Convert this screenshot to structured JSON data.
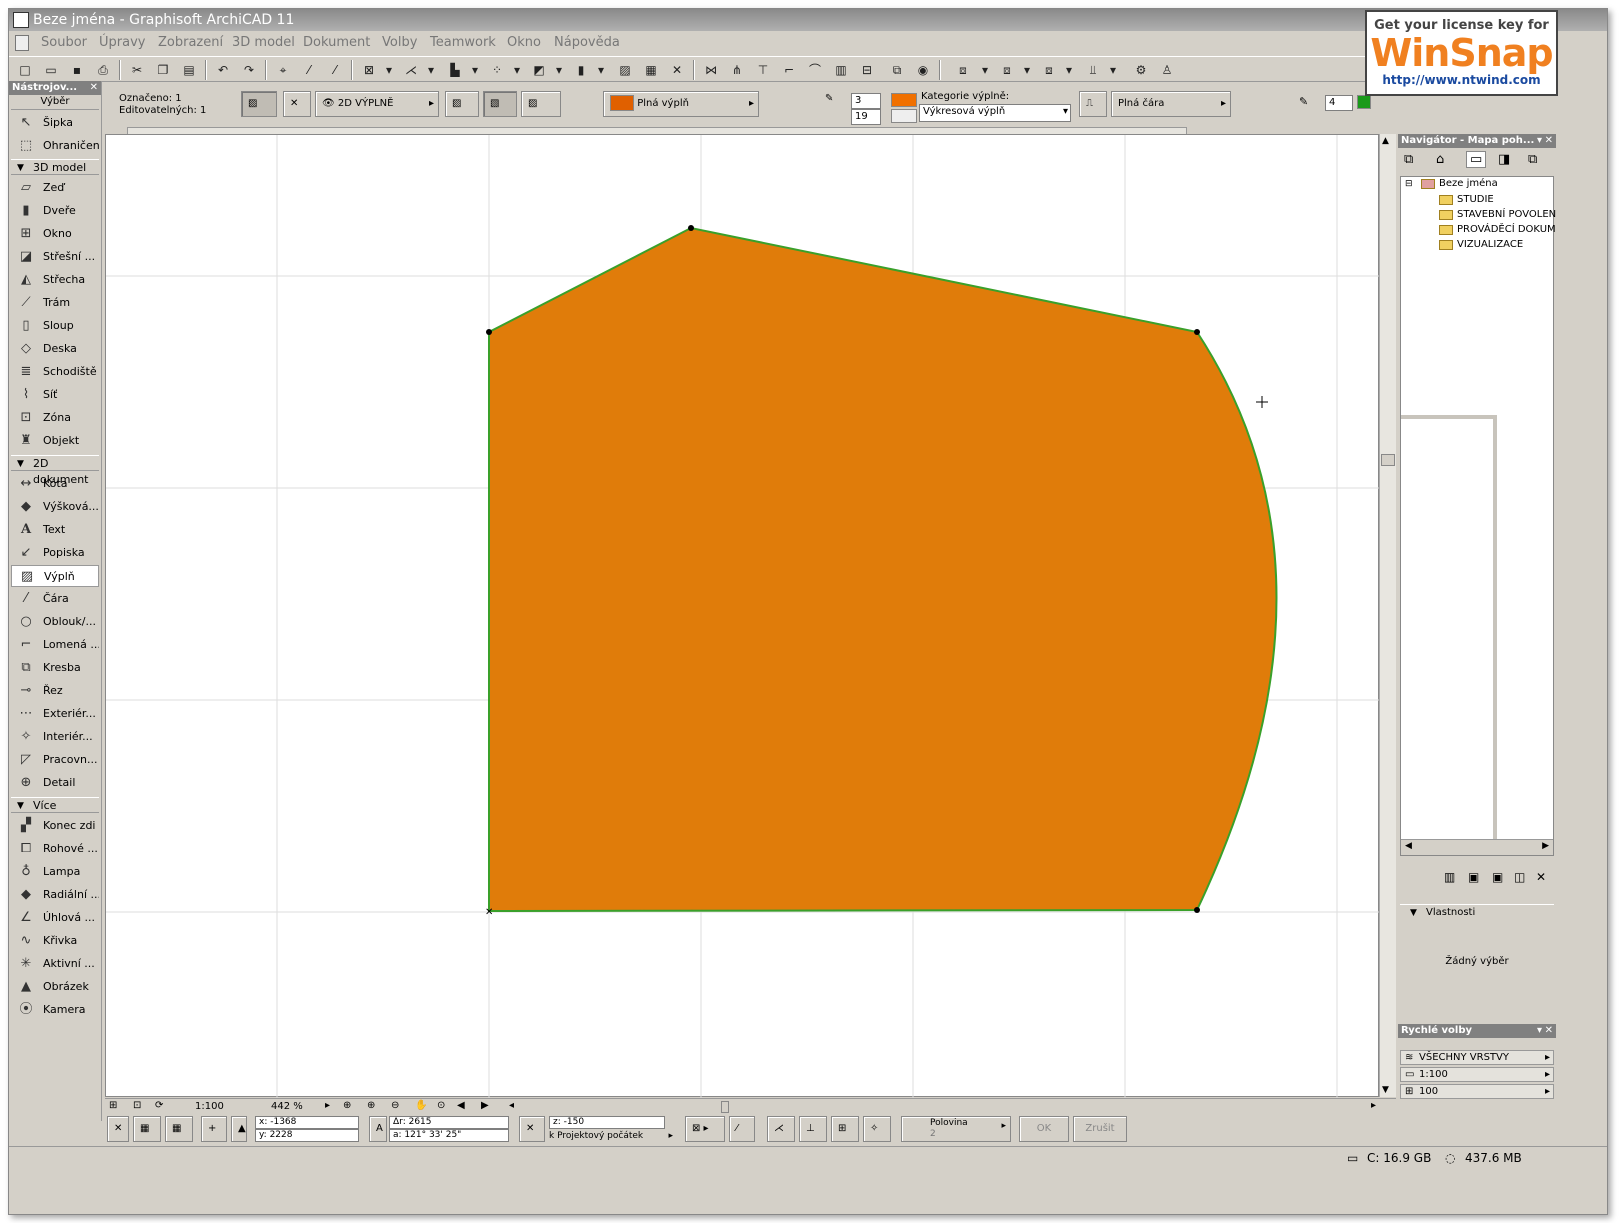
{
  "window": {
    "title": "Beze jména - Graphisoft ArchiCAD 11"
  },
  "menu": [
    "Soubor",
    "Úpravy",
    "Zobrazení",
    "3D model",
    "Dokument",
    "Volby",
    "Teamwork",
    "Okno",
    "Nápověda"
  ],
  "info_box": {
    "selected": "Označeno: 1",
    "editable": "Editovatelných: 1",
    "fill_mode": "2D VÝPLNĚ",
    "fill_type": "Plná výplň",
    "pen_1": "3",
    "pen_2": "19",
    "category_label": "Kategorie výplně:",
    "category_value": "Výkresová výplň",
    "line_type": "Plná čára",
    "pen_weight": "4"
  },
  "toolbox": {
    "title": "Nástrojov...",
    "select_header": "Výběr",
    "groups": {
      "model3d": "3D model",
      "doc2d": "2D dokument",
      "more": "Více"
    },
    "select_tools": [
      "Šipka",
      "Ohraničení"
    ],
    "model_tools": [
      "Zeď",
      "Dveře",
      "Okno",
      "Střešní ...",
      "Střecha",
      "Trám",
      "Sloup",
      "Deska",
      "Schodiště",
      "Síť",
      "Zóna",
      "Objekt"
    ],
    "doc_tools": [
      "Kóta",
      "Výšková...",
      "Text",
      "Popiska",
      "Výplň",
      "Čára",
      "Oblouk/...",
      "Lomená ...",
      "Kresba",
      "Řez",
      "Exteriér...",
      "Interiér...",
      "Pracovn...",
      "Detail"
    ],
    "more_tools": [
      "Konec zdi",
      "Rohové ...",
      "Lampa",
      "Radiální ...",
      "Úhlová ...",
      "Křivka",
      "Aktivní ...",
      "Obrázek",
      "Kamera"
    ]
  },
  "navigator": {
    "title": "Navigátor - Mapa poh...",
    "root": "Beze jména",
    "items": [
      "STUDIE",
      "STAVEBNÍ POVOLEN",
      "PROVÁDĚCÍ DOKUM",
      "VIZUALIZACE"
    ],
    "properties_label": "Vlastnosti",
    "no_selection": "Žádný výběr"
  },
  "quick_options": {
    "title": "Rychlé volby",
    "layers": "VŠECHNY VRSTVY",
    "scale": "1:100",
    "pen_set": "100"
  },
  "view_bar": {
    "scale": "1:100",
    "zoom": "442 %"
  },
  "coords": {
    "x": "x: -1368",
    "y": "y: 2228",
    "dr": "Δr: 2615",
    "a": "a: 121° 33' 25\"",
    "z": "z: -150",
    "origin": "k Projektový počátek",
    "snap": "Polovina",
    "snap_val": "2",
    "ok": "OK",
    "cancel": "Zrušit"
  },
  "status": {
    "disk": "C: 16.9 GB",
    "memory": "437.6 MB"
  },
  "watermark": {
    "line1": "Get your license key for",
    "brand": "WinSnap",
    "url": "http://www.ntwind.com"
  },
  "colors": {
    "fill": "#e07c0a",
    "outline": "#3aa02a",
    "accent": "#808080"
  }
}
